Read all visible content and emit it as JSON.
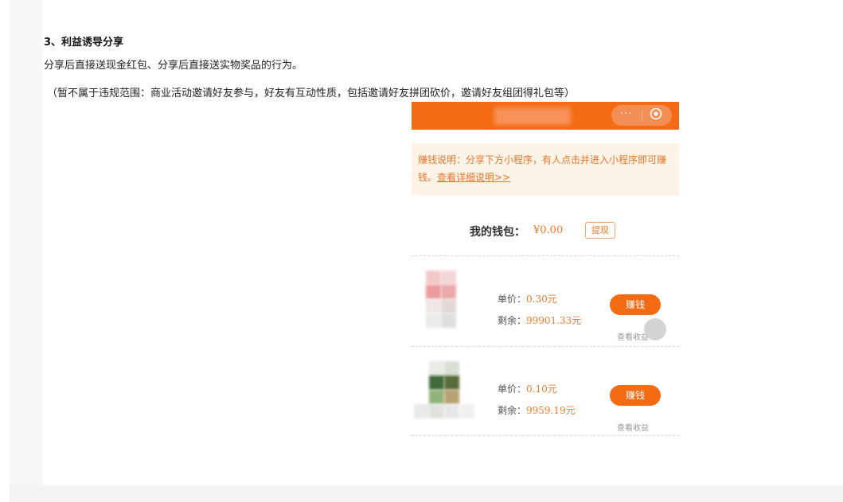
{
  "article": {
    "heading": "3、利益诱导分享",
    "line1": "分享后直接送现金红包、分享后直接送实物奖品的行为。",
    "line2": "（暂不属于违规范围：商业活动邀请好友参与，好友有互动性质，包括邀请好友拼团砍价，邀请好友组团得礼包等）"
  },
  "mini_program": {
    "capsule": {
      "more_icon": "···",
      "target_icon": "target-icon"
    },
    "notice": {
      "text": "赚钱说明：分享下方小程序，有人点击并进入小程序即可赚钱。",
      "link": "查看详细说明>>"
    },
    "wallet": {
      "label": "我的钱包：",
      "amount": "¥0.00",
      "withdraw": "提现"
    },
    "items": [
      {
        "unit_label": "单价：",
        "unit_value": "0.30元",
        "remain_label": "剩余：",
        "remain_value": "99901.33元",
        "earn": "赚钱",
        "profit": "查看收益"
      },
      {
        "unit_label": "单价：",
        "unit_value": "0.10元",
        "remain_label": "剩余：",
        "remain_value": "9959.19元",
        "earn": "赚钱",
        "profit": "查看收益"
      }
    ]
  },
  "colors": {
    "accent": "#f56b13",
    "price": "#ee7a2a",
    "notice_bg": "#fdf3e6"
  }
}
